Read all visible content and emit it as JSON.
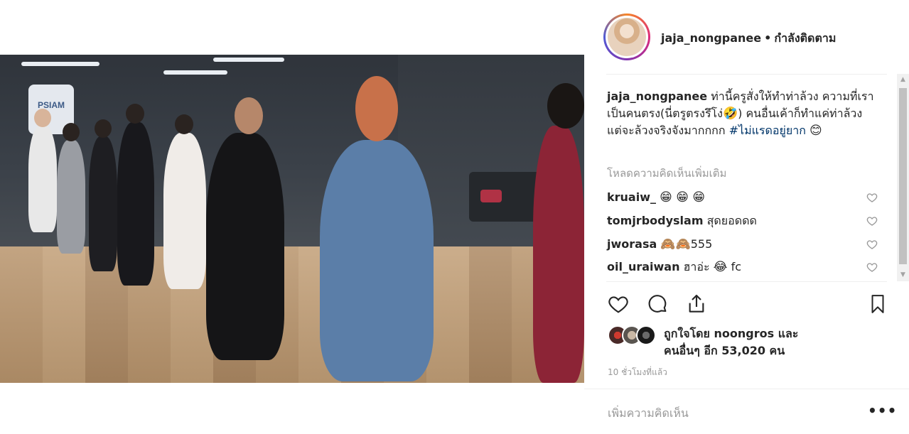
{
  "header": {
    "username": "jaja_nongpanee",
    "separator": "•",
    "follow_status": "กำลังติดตาม"
  },
  "video": {
    "banner_text": "PSIAM"
  },
  "caption": {
    "username": "jaja_nongpanee",
    "text_part1": "ท่านี้ครูสั่งให้ทำท่าล้วง ความที่เราเป็นคนตรง(นี่ตรูตรงรึโง่",
    "emoji1": "🤣",
    "text_part2": ") คนอื่นเค้าก็ทำแค่ท่าล้วง แต่จะล้วงจริงจังมากกกก ",
    "hashtag": "#ไม่แรดอยู่ยาก",
    "emoji2": "😊"
  },
  "load_more": "โหลดความคิดเห็นเพิ่มเติม",
  "comments": [
    {
      "username": "kruaiw_",
      "text": "",
      "emojis": "😁 😁 😁"
    },
    {
      "username": "tomjrbodyslam",
      "text": "สุดยอดดด",
      "emojis": ""
    },
    {
      "username": "jworasa",
      "text": "555",
      "emojis": "🙈🙈"
    },
    {
      "username": "oil_uraiwan",
      "text": "ฮาอ่ะ",
      "emojis": "😂",
      "suffix": "fc"
    }
  ],
  "likes": {
    "line1": "ถูกใจโดย noongros และ",
    "line2": "คนอื่นๆ อีก 53,020 คน"
  },
  "timestamp": "10 ชั่วโมงที่แล้ว",
  "add_comment_placeholder": "เพิ่มความคิดเห็น",
  "more_options": "•••",
  "colors": {
    "text": "#262626",
    "muted": "#999999",
    "hashtag": "#003569",
    "divider": "#efefef"
  },
  "icons": {
    "like": "heart-outline-icon",
    "comment": "speech-bubble-icon",
    "share": "share-upload-icon",
    "save": "bookmark-icon",
    "comment_like": "small-heart-icon"
  }
}
